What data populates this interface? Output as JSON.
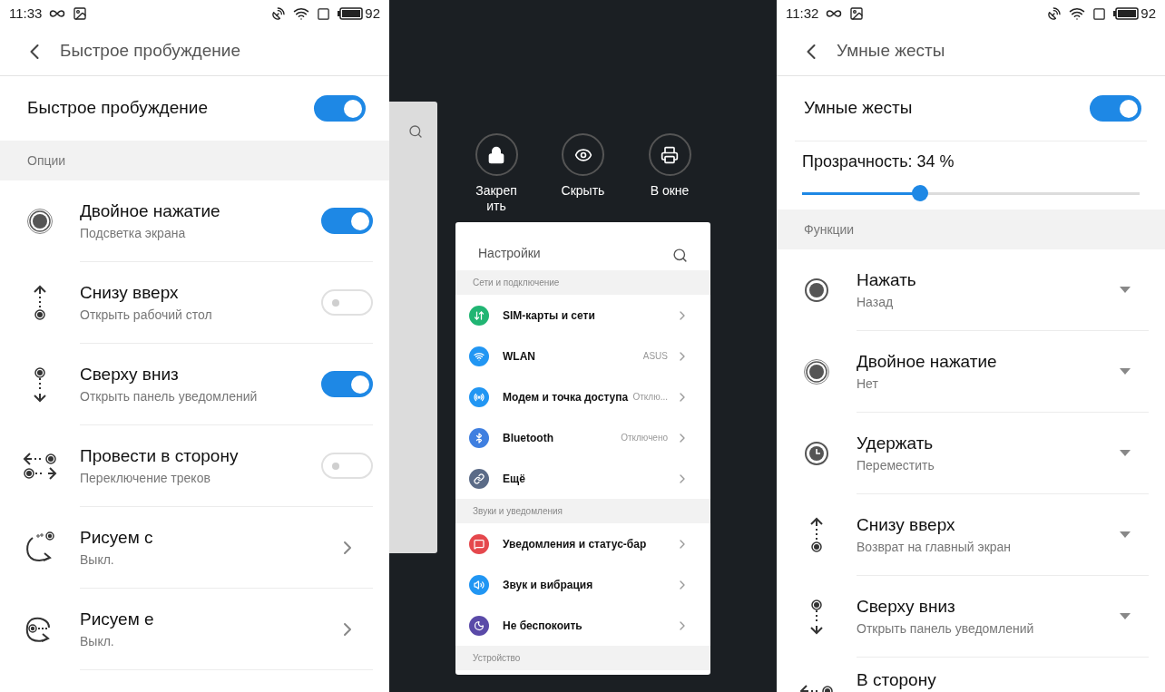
{
  "left": {
    "status_bar": {
      "time": "11:33",
      "battery": "92"
    },
    "title": "Быстрое пробуждение",
    "master": {
      "label": "Быстрое пробуждение",
      "on": true
    },
    "section": "Опции",
    "items": [
      {
        "kind": "toggle",
        "title": "Двойное нажатие",
        "subtitle": "Подсветка экрана",
        "on": true
      },
      {
        "kind": "toggle",
        "title": "Снизу вверх",
        "subtitle": "Открыть рабочий стол",
        "on": false
      },
      {
        "kind": "toggle",
        "title": "Сверху вниз",
        "subtitle": "Открыть панель уведомлений",
        "on": true
      },
      {
        "kind": "toggle",
        "title": "Провести в сторону",
        "subtitle": "Переключение треков",
        "on": false
      },
      {
        "kind": "link",
        "title": "Рисуем c",
        "subtitle": "Выкл."
      },
      {
        "kind": "link",
        "title": "Рисуем e",
        "subtitle": "Выкл."
      }
    ]
  },
  "middle": {
    "actions": [
      {
        "label": "Закрепить"
      },
      {
        "label": "Скрыть"
      },
      {
        "label": "В окне"
      }
    ],
    "app": {
      "title": "Настройки",
      "groups": [
        {
          "header": "Сети и подключение",
          "rows": [
            {
              "label": "SIM-карты и сети",
              "color": "#21b573"
            },
            {
              "label": "WLAN",
              "value": "ASUS",
              "color": "#2196f3"
            },
            {
              "label": "Модем и точка доступа",
              "value": "Отклю...",
              "color": "#2196f3"
            },
            {
              "label": "Bluetooth",
              "value": "Отключено",
              "color": "#3f7fe0"
            },
            {
              "label": "Ещё",
              "color": "#5b6b87"
            }
          ]
        },
        {
          "header": "Звуки и уведомления",
          "rows": [
            {
              "label": "Уведомления и статус-бар",
              "color": "#e5484d"
            },
            {
              "label": "Звук и вибрация",
              "color": "#2196f3"
            },
            {
              "label": "Не беспокоить",
              "color": "#5a4aa8"
            }
          ]
        },
        {
          "header": "Устройство"
        }
      ]
    }
  },
  "right": {
    "status_bar": {
      "time": "11:32",
      "battery": "92"
    },
    "title": "Умные жесты",
    "master": {
      "label": "Умные жесты",
      "on": true
    },
    "slider": {
      "label": "Прозрачность: 34 %",
      "level": 0.35
    },
    "section": "Функции",
    "items": [
      {
        "kind": "dropdown",
        "title": "Нажать",
        "subtitle": "Назад"
      },
      {
        "kind": "dropdown",
        "title": "Двойное нажатие",
        "subtitle": "Нет"
      },
      {
        "kind": "dropdown",
        "title": "Удержать",
        "subtitle": "Переместить"
      },
      {
        "kind": "dropdown",
        "title": "Снизу вверх",
        "subtitle": "Возврат на главный экран"
      },
      {
        "kind": "dropdown",
        "title": "Сверху вниз",
        "subtitle": "Открыть панель уведомлений"
      },
      {
        "kind": "dropdown",
        "title": "В сторону"
      }
    ]
  }
}
